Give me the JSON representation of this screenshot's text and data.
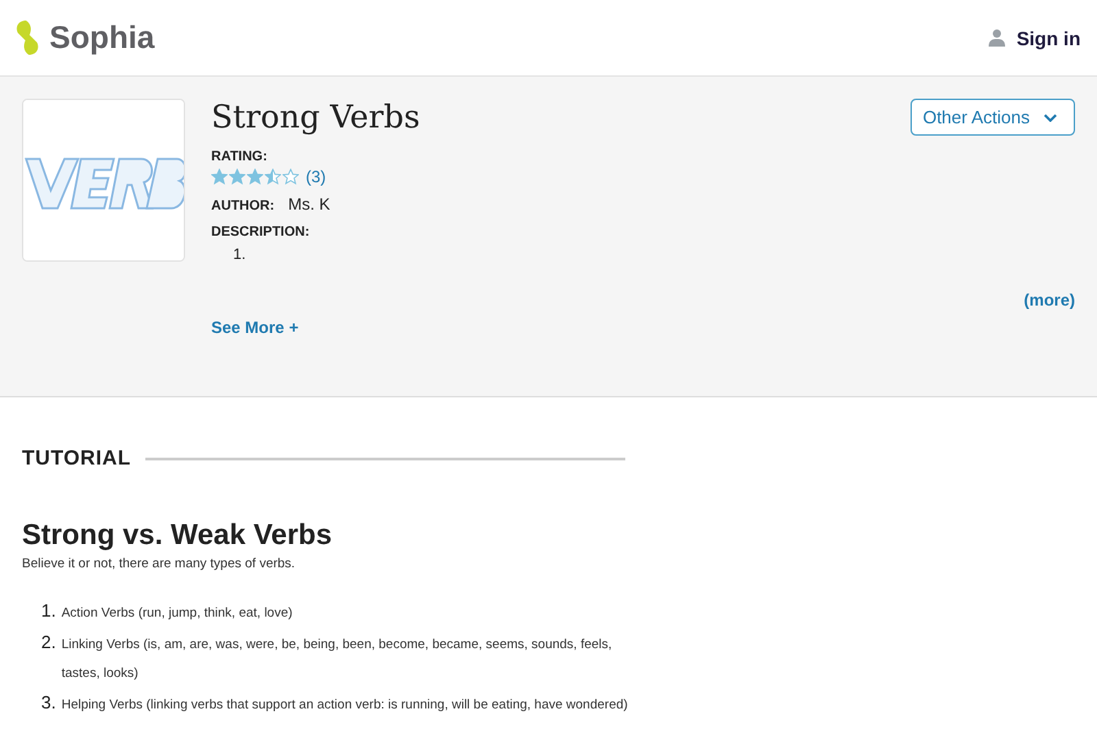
{
  "header": {
    "brand": "Sophia",
    "sign_in": "Sign in"
  },
  "resource": {
    "title": "Strong Verbs",
    "actions_button": "Other Actions",
    "rating_label": "RATING:",
    "stars": 3.5,
    "rating_count": "(3)",
    "author_label": "AUTHOR:",
    "author": "Ms. K",
    "description_label": "DESCRIPTION:",
    "description_items": [
      "1."
    ],
    "more_link": "(more)",
    "see_more": "See More +"
  },
  "tutorial": {
    "section_label": "TUTORIAL",
    "heading": "Strong vs. Weak Verbs",
    "intro": "Believe it or not, there are many types of verbs.",
    "items": [
      {
        "number": "1.",
        "text": "Action Verbs  (run, jump, think, eat, love)"
      },
      {
        "number": "2.",
        "text": "Linking Verbs (is, am, are, was, were, be, being, been, become, became, seems, sounds, feels, tastes, looks)"
      },
      {
        "number": "3.",
        "text": "Helping Verbs (linking verbs that support an action verb: is running, will be eating, have wondered)"
      }
    ]
  }
}
